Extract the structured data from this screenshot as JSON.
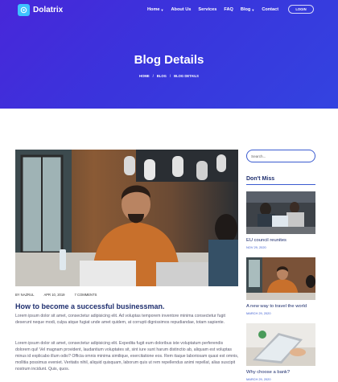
{
  "brand": {
    "name": "Dolatrix"
  },
  "nav": {
    "items": [
      {
        "label": "Home",
        "dropdown": true
      },
      {
        "label": "About Us",
        "dropdown": false
      },
      {
        "label": "Services",
        "dropdown": false
      },
      {
        "label": "FAQ",
        "dropdown": false
      },
      {
        "label": "Blog",
        "dropdown": true
      },
      {
        "label": "Contact",
        "dropdown": false
      }
    ],
    "login_label": "LOGIN"
  },
  "hero": {
    "title": "Blog Details",
    "breadcrumb": [
      "HOME",
      "BLOG",
      "BLOG DETAILS"
    ]
  },
  "post": {
    "author": "BY NAZRUL",
    "date": "APR 10, 2019",
    "comments": "7 COMMENTS",
    "title": "How to become a successful businessman.",
    "paragraphs": [
      "Lorem ipsum dolor sit amet, consectetur adipisicing elit. Ad voluptas temporem inventore minima consectetur fugit deserunt neque modi, culpa atque fugiat unde amet quidem, at corrupti dignissimos repudiandae, totam sapiente.",
      "Lorem ipsum dolor sit amet, consectetur adipisicing elit. Expedita fugit eum doloribus iste voluptatum perferendis dolorem qui! Vel magnam provident, laudantium voluptates sit, sint iure sunt harum distinctio ab, aliquam est voluptas minus id explicabo illum odio? Officia omnis minima similique, exercitatione eos. Rem itaque laboriosam quasi est omnis, mollitia possimus eveniet. Veritatis nihil, aliquid quisquam, laborum quis ut rem repellendus animi repellat, alias suscipit nostrum incidunt. Quis, quos."
    ]
  },
  "sidebar": {
    "search_placeholder": "Search...",
    "dont_miss_title": "Don't Miss",
    "items": [
      {
        "title": "EU council reunites",
        "date": "NOV 29, 2020"
      },
      {
        "title": "A new way to travel the world",
        "date": "MARCH 29, 2020"
      },
      {
        "title": "Why choose a bank?",
        "date": "MARCH 29, 2020"
      }
    ]
  },
  "colors": {
    "hero_start": "#4827d9",
    "hero_end": "#3343e0",
    "accent": "#3a5bd0",
    "heading": "#1e2e6e",
    "logo_mark": "#3ec3ff"
  }
}
